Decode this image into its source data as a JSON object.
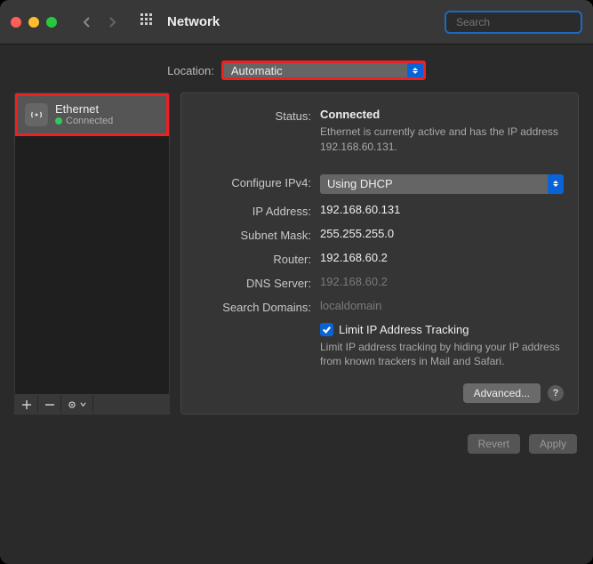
{
  "window": {
    "title": "Network"
  },
  "search": {
    "placeholder": "Search"
  },
  "location": {
    "label": "Location:",
    "value": "Automatic"
  },
  "sidebar": {
    "items": [
      {
        "name": "Ethernet",
        "status": "Connected"
      }
    ]
  },
  "controls": {
    "add": "+",
    "remove": "−",
    "gear": "⚙",
    "dropdown": "⌄"
  },
  "details": {
    "status_label": "Status:",
    "status_value": "Connected",
    "status_desc": "Ethernet is currently active and has the IP address 192.168.60.131.",
    "configure_label": "Configure IPv4:",
    "configure_value": "Using DHCP",
    "ip_label": "IP Address:",
    "ip_value": "192.168.60.131",
    "subnet_label": "Subnet Mask:",
    "subnet_value": "255.255.255.0",
    "router_label": "Router:",
    "router_value": "192.168.60.2",
    "dns_label": "DNS Server:",
    "dns_value": "192.168.60.2",
    "search_label": "Search Domains:",
    "search_value": "localdomain",
    "limit_label": "Limit IP Address Tracking",
    "limit_desc": "Limit IP address tracking by hiding your IP address from known trackers in Mail and Safari.",
    "advanced": "Advanced...",
    "help": "?"
  },
  "footer": {
    "revert": "Revert",
    "apply": "Apply"
  }
}
